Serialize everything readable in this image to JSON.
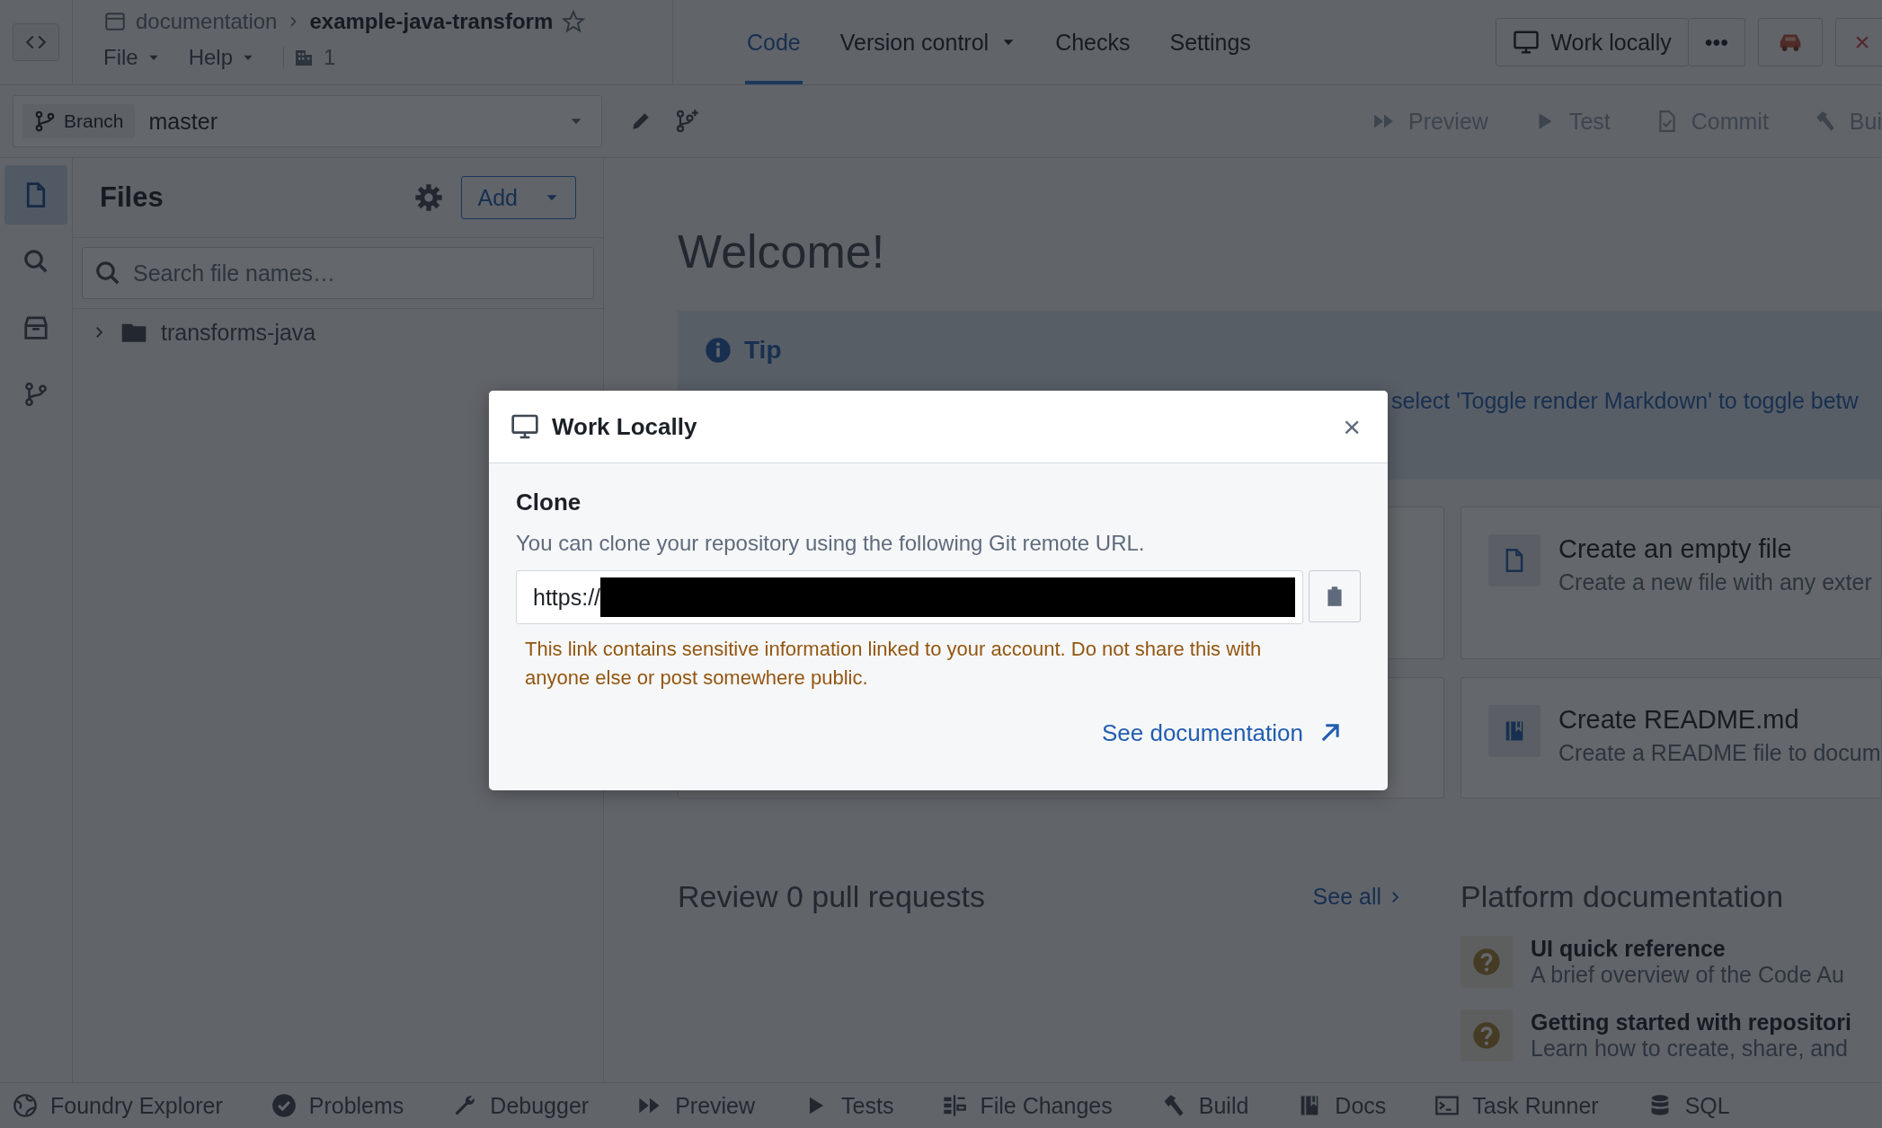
{
  "header": {
    "breadcrumb": [
      "documentation",
      "example-java-transform"
    ],
    "starred": false,
    "menus": [
      "File",
      "Help"
    ],
    "members": "1",
    "tabs": [
      {
        "label": "Code",
        "selected": true,
        "dropdown": false
      },
      {
        "label": "Version control",
        "selected": false,
        "dropdown": true
      },
      {
        "label": "Checks",
        "selected": false,
        "dropdown": false
      },
      {
        "label": "Settings",
        "selected": false,
        "dropdown": false
      }
    ],
    "work_locally": "Work locally",
    "more": "•••",
    "close": "×"
  },
  "toolbar": {
    "branch_label": "Branch",
    "branch": "master",
    "actions": [
      "Preview",
      "Test",
      "Commit",
      "Bui"
    ]
  },
  "rail": [
    {
      "selected": true
    },
    {
      "selected": false
    },
    {
      "selected": false
    },
    {
      "selected": false
    }
  ],
  "files": {
    "title": "Files",
    "add": "Add",
    "search": {
      "placeholder": "Search file names…"
    },
    "tree": [
      {
        "name": "transforms-java",
        "expanded": false
      }
    ]
  },
  "welcome": {
    "title": "Welcome!",
    "tip": {
      "title": "Tip",
      "text": "select 'Toggle render Markdown' to toggle betw"
    },
    "cards": [
      {
        "title": "Create an empty file",
        "description": "Create a new file with any exter"
      },
      {
        "title": "Create README.md",
        "description": "Create a README file to docum"
      }
    ]
  },
  "review": {
    "title": "Review 0 pull requests",
    "see_all": "See all"
  },
  "docs": {
    "title": "Platform documentation",
    "items": [
      {
        "title": "UI quick reference",
        "description": "A brief overview of the Code Au"
      },
      {
        "title": "Getting started with repositori",
        "description": "Learn how to create, share, and"
      }
    ]
  },
  "bottom_bar": [
    "Foundry Explorer",
    "Problems",
    "Debugger",
    "Preview",
    "Tests",
    "File Changes",
    "Build",
    "Docs",
    "Task Runner",
    "SQL"
  ],
  "dialog": {
    "title": "Work Locally",
    "close": "×",
    "section": "Clone",
    "description": "You can clone your repository using the following Git remote URL.",
    "url": {
      "value": "https://"
    },
    "warning": "This link contains sensitive information linked to your account. Do not share this with anyone else or post somewhere public.",
    "link": "See documentation"
  }
}
